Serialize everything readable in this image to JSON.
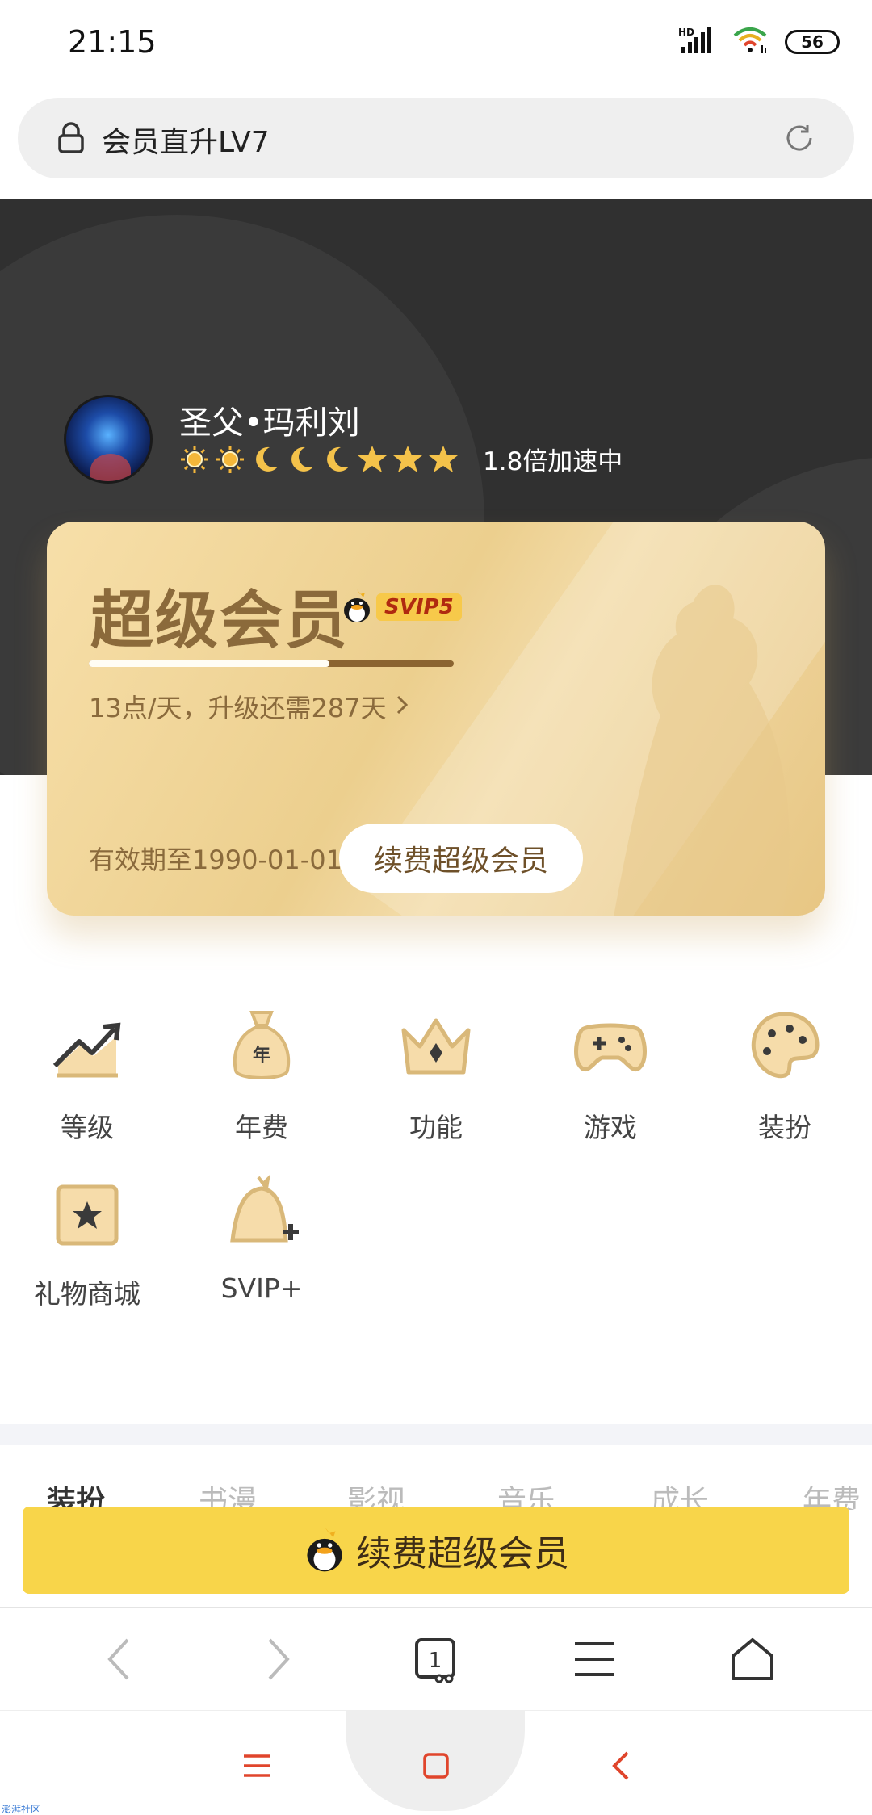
{
  "status_bar": {
    "time": "21:15",
    "signal_label": "HD",
    "battery": "56"
  },
  "address_bar": {
    "title": "会员直升LV7"
  },
  "profile": {
    "name": "圣父•玛利刘",
    "level_icons": [
      "sun-icon",
      "sun-icon",
      "moon-icon",
      "moon-icon",
      "moon-icon",
      "star-icon",
      "star-icon",
      "star-icon"
    ],
    "speed": "1.8倍加速中"
  },
  "card": {
    "title": "超级会员",
    "badge": "SVIP5",
    "progress": 0.66,
    "subtitle": "13点/天，升级还需287天",
    "expiry": "有效期至1990-01-01",
    "renew_button": "续费超级会员"
  },
  "grid": [
    {
      "label": "等级",
      "icon": "chart-up-icon"
    },
    {
      "label": "年费",
      "icon": "money-bag-icon"
    },
    {
      "label": "功能",
      "icon": "crown-icon"
    },
    {
      "label": "游戏",
      "icon": "gamepad-icon"
    },
    {
      "label": "装扮",
      "icon": "palette-icon"
    },
    {
      "label": "礼物商城",
      "icon": "gift-icon"
    },
    {
      "label": "SVIP+",
      "icon": "penguin-plus-icon"
    }
  ],
  "tabs": [
    "装扮",
    "书漫",
    "影视",
    "音乐",
    "成长",
    "年费"
  ],
  "bottom_cta": {
    "label": "续费超级会员"
  },
  "browser_bar": {
    "tab_count": "1"
  },
  "watermark": "澎湃社区",
  "colors": {
    "accent": "#f8d54a",
    "card_gold": "#eccf8e",
    "hero_bg": "#303030",
    "nav_red": "#e0452c"
  }
}
